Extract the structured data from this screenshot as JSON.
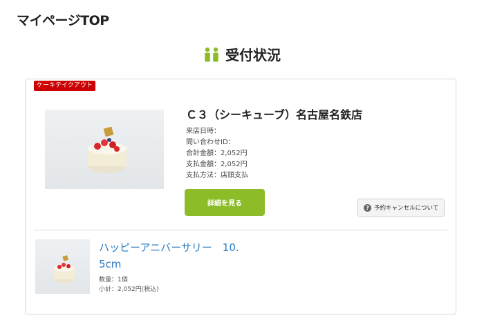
{
  "page": {
    "title": "マイページTOP"
  },
  "section": {
    "title": "受付状況",
    "icon": "people-icon"
  },
  "order": {
    "badge": "ケーキテイクアウト",
    "store_name": "Ｃ３（シーキューブ）名古屋名鉄店",
    "details": [
      "来店日時：",
      "問い合わせID：",
      "合計金額：2,052円",
      "支払金額：2,052円",
      "支払方法：店頭支払"
    ],
    "detail_button": "詳細を見る",
    "cancel_button": "予約キャンセルについて",
    "cancel_icon_char": "?"
  },
  "item": {
    "name_line1": "ハッピーアニバーサリー　10.",
    "name_line2": "5cm",
    "quantity": "数量：1個",
    "subtotal": "小計：2,052円(税込)"
  },
  "colors": {
    "accent": "#8cbd28",
    "badge": "#cc0000",
    "link": "#2a7bc0"
  }
}
